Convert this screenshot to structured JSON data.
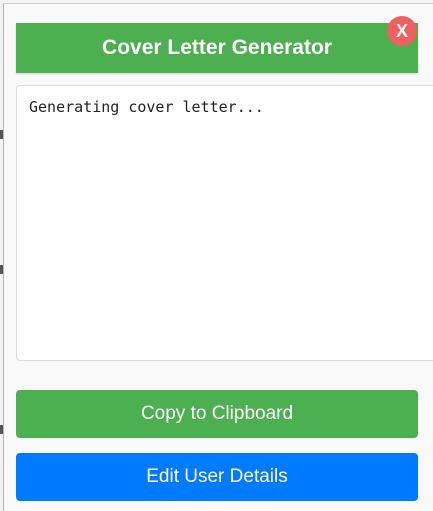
{
  "header": {
    "title": "Cover Letter Generator",
    "close_label": "X"
  },
  "output": {
    "text": "Generating cover letter..."
  },
  "actions": {
    "copy_label": "Copy to Clipboard",
    "edit_label": "Edit User Details"
  },
  "colors": {
    "header": "#4caf50",
    "copy_button": "#4caf50",
    "edit_button": "#007bff",
    "close_button": "#f06060"
  }
}
